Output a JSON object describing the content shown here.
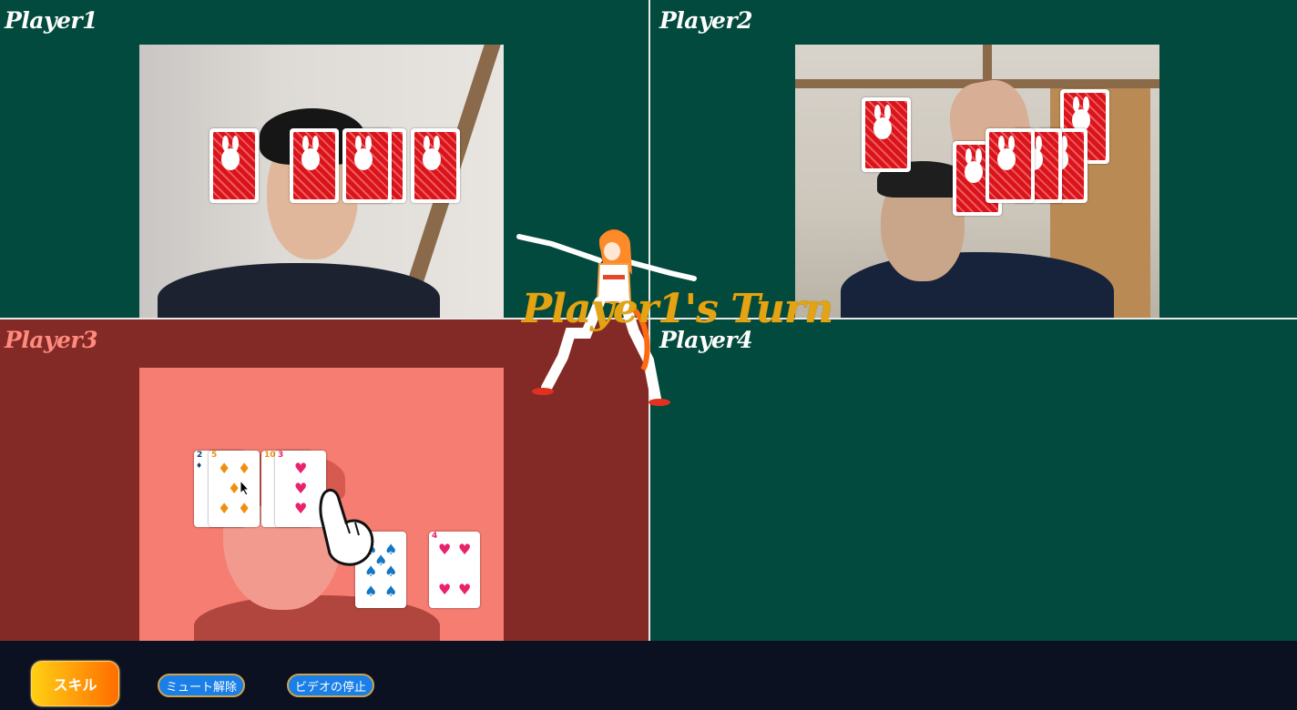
{
  "players": [
    {
      "name": "Player1"
    },
    {
      "name": "Player2"
    },
    {
      "name": "Player3"
    },
    {
      "name": "Player4"
    }
  ],
  "turn_label": "Player1's Turn",
  "hand_player3": [
    {
      "rank": "2",
      "suit": "diamond"
    },
    {
      "rank": "5",
      "suit": "diamond"
    },
    {
      "rank": "10",
      "suit": "diamond"
    },
    {
      "rank": "3",
      "suit": "heart"
    }
  ],
  "table_cards": [
    {
      "rank": "7",
      "suit": "spade"
    },
    {
      "rank": "4",
      "suit": "heart"
    }
  ],
  "controls": {
    "skill_label": "スキル",
    "mute_label": "ミュート解除",
    "video_label": "ビデオの停止"
  },
  "colors": {
    "felt_green": "#024a3d",
    "active_red": "#842a26",
    "turn_gold": "#e4a312",
    "bar": "#0b1120"
  },
  "icons": [
    "bunny-card-back",
    "pointing-hand-icon",
    "cursor-icon",
    "mascot-dancer"
  ]
}
